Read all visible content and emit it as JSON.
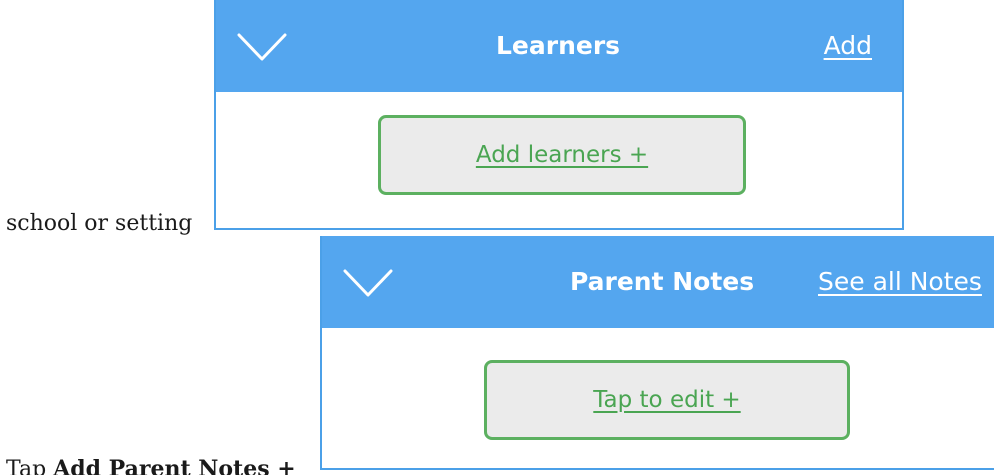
{
  "document": {
    "line_1": "school or setting",
    "line_2_prefix": "Tap ",
    "line_2_bold": "Add Parent Notes +"
  },
  "learners_panel": {
    "title": "Learners",
    "header_link": "Add",
    "action_label": "Add learners +",
    "chevron_icon": "chevron-down-icon"
  },
  "notes_panel": {
    "title": "Parent Notes",
    "header_link": "See all Notes",
    "action_label": "Tap to edit +",
    "chevron_icon": "chevron-down-icon"
  },
  "colors": {
    "header_blue": "#54a6ef",
    "border_blue": "#4ba0e8",
    "action_green": "#5cb060",
    "action_background": "#ebebeb"
  }
}
